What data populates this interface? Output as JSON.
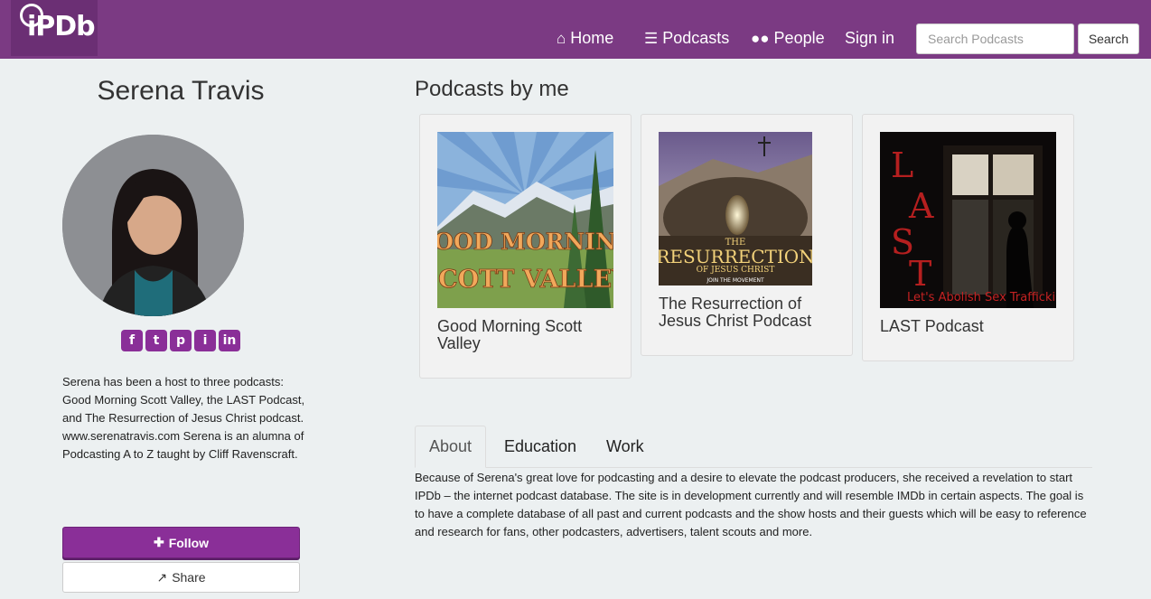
{
  "brand": {
    "logo_text": "iPDb"
  },
  "nav": {
    "items": [
      {
        "icon": "home-icon",
        "label": "Home"
      },
      {
        "icon": "list-icon",
        "label": "Podcasts"
      },
      {
        "icon": "people-icon",
        "label": "People"
      },
      {
        "icon": "",
        "label": "Sign in"
      }
    ],
    "search_placeholder": "Search Podcasts",
    "search_label": "Search"
  },
  "profile": {
    "name": "Serena Travis",
    "social": [
      "f",
      "t",
      "p",
      "i",
      "in"
    ],
    "bio": "Serena has been a host to three podcasts: Good Morning Scott Valley, the LAST Podcast, and The Resurrection of Jesus Christ podcast. www.serenatravis.com Serena is an alumna of Podcasting A to Z taught by Cliff Ravenscraft.",
    "follow_label": "Follow",
    "share_label": "Share"
  },
  "podcasts": {
    "title": "Podcasts by me",
    "items": [
      {
        "title": "Good Morning Scott Valley",
        "cover_text": [
          "GOOD MORNING",
          "SCOTT VALLEY"
        ]
      },
      {
        "title": "The Resurrection of Jesus Christ Podcast",
        "cover_text": [
          "THE",
          "RESURRECTION",
          "OF JESUS CHRIST",
          "JOIN THE MOVEMENT"
        ]
      },
      {
        "title": "LAST Podcast",
        "cover_text": [
          "L",
          "A",
          "S",
          "T",
          "Let's Abolish Sex Trafficking"
        ]
      }
    ]
  },
  "tabs": {
    "items": [
      "About",
      "Education",
      "Work"
    ],
    "active": "About",
    "about_text": "Because of Serena's great love for podcasting and a desire to elevate the podcast producers, she received a revelation to start IPDb – the internet podcast database. The site is in development currently and will resemble IMDb in certain aspects. The goal is to have a complete database of all past and current podcasts and the show hosts and their guests which will be easy to reference and research for fans, other podcasters, advertisers, talent scouts and more."
  },
  "colors": {
    "brand": "#7b3a83",
    "accent": "#8a2f98",
    "background": "#ecf0f1"
  }
}
